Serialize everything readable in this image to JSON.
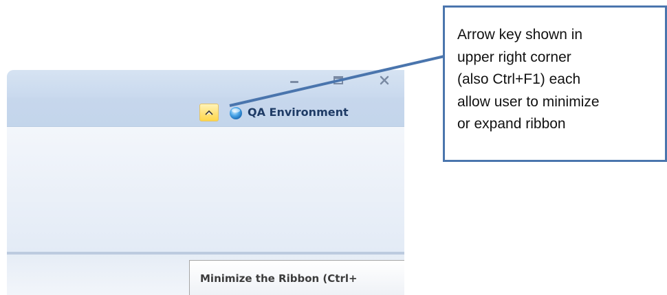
{
  "window": {
    "environment_label": "QA Environment",
    "toggle_button_icon": "chevron-up-icon",
    "environment_icon": "globe-icon",
    "caption_buttons": [
      "minimize-icon",
      "maximize-icon",
      "close-icon"
    ]
  },
  "tooltip": {
    "text": "Minimize the Ribbon (Ctrl+"
  },
  "callout": {
    "text": "Arrow key shown in\nupper right corner\n(also Ctrl+F1) each\nallow user to minimize\nor expand ribbon",
    "border_color": "#4a75ad"
  },
  "colors": {
    "toggle_highlight": "#ffd84a",
    "ribbon_header": "#c7d7ec",
    "label_text": "#1f3c66"
  }
}
